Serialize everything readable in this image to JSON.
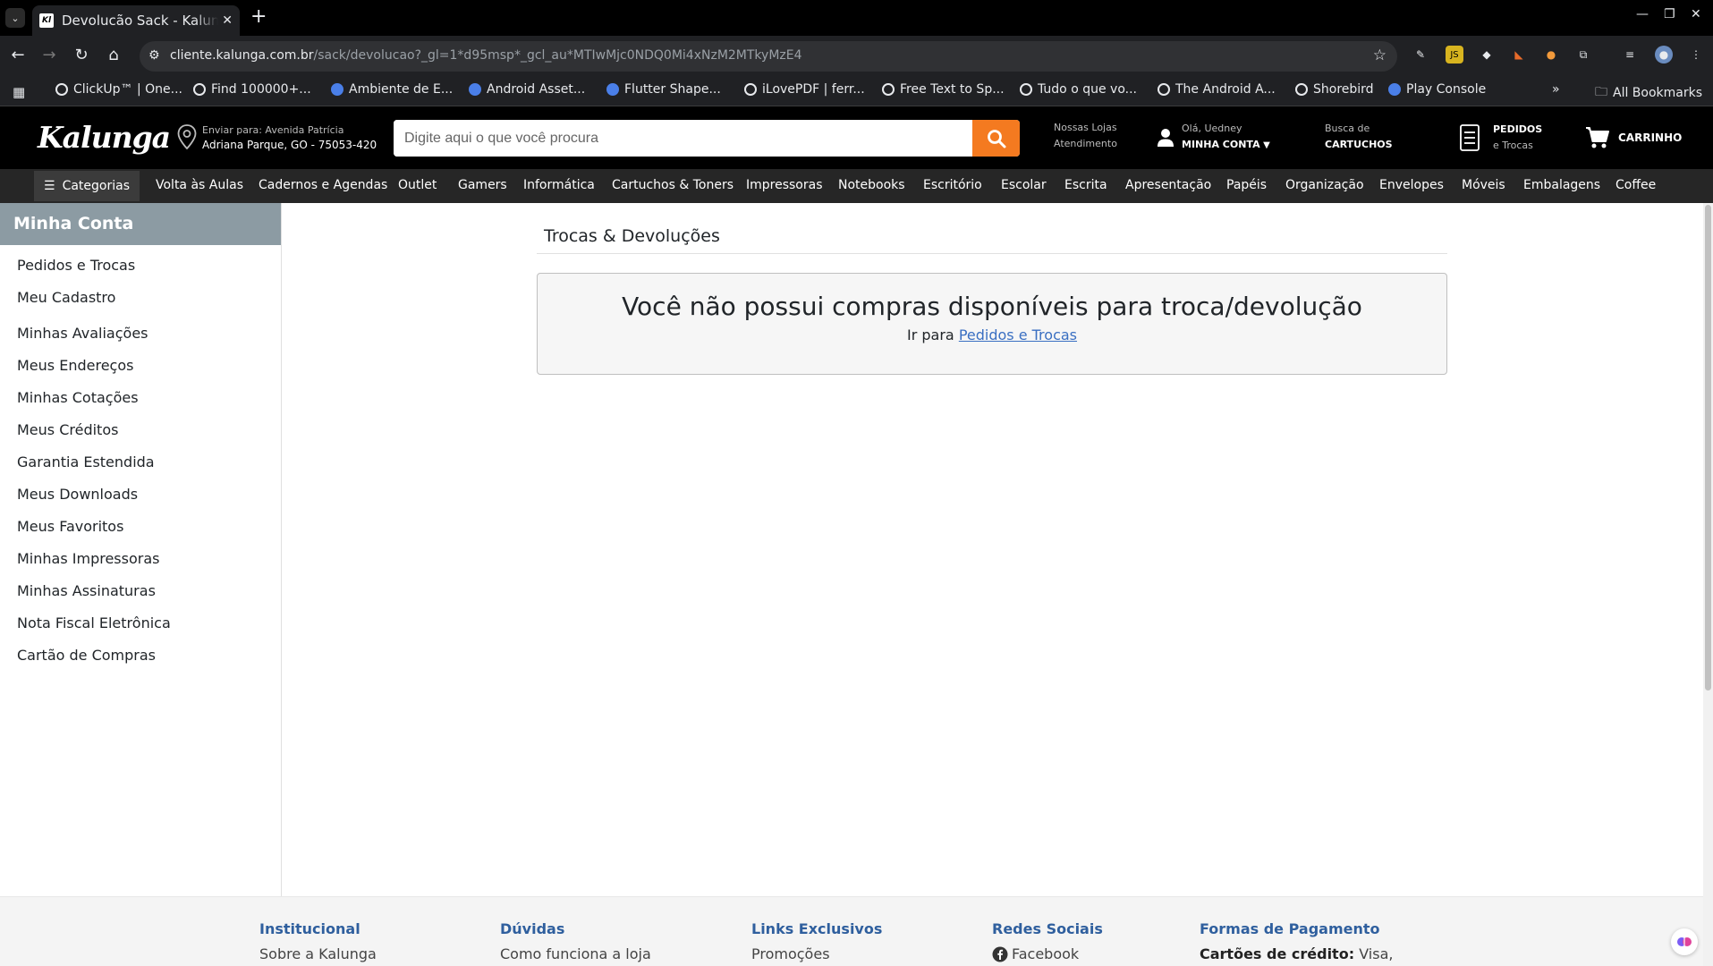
{
  "browser": {
    "tab_title": "Devolucão Sack - Kalunga",
    "tab_favicon": "Kl",
    "url_host": "cliente.kalunga.com.br",
    "url_path": "/sack/devolucao?_gl=1*d95msp*_gcl_au*MTIwMjc0NDQ0Mi4xNzM2MTkyMzE4",
    "bookmarks": [
      "ClickUp™ | One...",
      "Find 100000+...",
      "Ambiente de E...",
      "Android Asset...",
      "Flutter Shape...",
      "iLovePDF | ferr...",
      "Free Text to Sp...",
      "Tudo o que vo...",
      "The Android A...",
      "Shorebird",
      "Play Console"
    ],
    "all_bookmarks": "All Bookmarks",
    "overflow": "»"
  },
  "header": {
    "logo": "Kalunga",
    "ship_label": "Enviar para: Avenida Patrícia",
    "ship_address": "Adriana Parque, GO - 75053-420",
    "search_placeholder": "Digite aqui o que você procura",
    "stores": "Nossas Lojas",
    "support": "Atendimento",
    "greeting": "Olá, Uedney",
    "account": "MINHA CONTA",
    "cartridge_top": "Busca de",
    "cartridge_bottom": "CARTUCHOS",
    "orders_top": "PEDIDOS",
    "orders_bottom": "e Trocas",
    "cart": "CARRINHO",
    "brand_color": "#f47a20"
  },
  "categories": {
    "button": "Categorias",
    "items": [
      "Volta às Aulas",
      "Cadernos e Agendas",
      "Outlet",
      "Gamers",
      "Informática",
      "Cartuchos & Toners",
      "Impressoras",
      "Notebooks",
      "Escritório",
      "Escolar",
      "Escrita",
      "Apresentação",
      "Papéis",
      "Organização",
      "Envelopes",
      "Móveis",
      "Embalagens",
      "Coffee"
    ]
  },
  "sidebar": {
    "title": "Minha Conta",
    "items": [
      "Pedidos e Trocas",
      "Meu Cadastro",
      "Minhas Avaliações",
      "Meus Endereços",
      "Minhas Cotações",
      "Meus Créditos",
      "Garantia Estendida",
      "Meus Downloads",
      "Meus Favoritos",
      "Minhas Impressoras",
      "Minhas Assinaturas",
      "Nota Fiscal Eletrônica",
      "Cartão de Compras"
    ]
  },
  "main": {
    "title": "Trocas & Devoluções",
    "message": "Você não possui compras disponíveis para troca/devolução",
    "goto_prefix": "Ir para",
    "goto_link": "Pedidos e Trocas"
  },
  "footer": {
    "columns": [
      {
        "title": "Institucional",
        "first": "Sobre a Kalunga"
      },
      {
        "title": "Dúvidas",
        "first": "Como funciona a loja"
      },
      {
        "title": "Links Exclusivos",
        "first": "Promoções"
      },
      {
        "title": "Redes Sociais",
        "first": "Facebook"
      },
      {
        "title": "Formas de Pagamento",
        "first_bold": "Cartões de crédito:",
        "first": "Visa,"
      }
    ]
  }
}
